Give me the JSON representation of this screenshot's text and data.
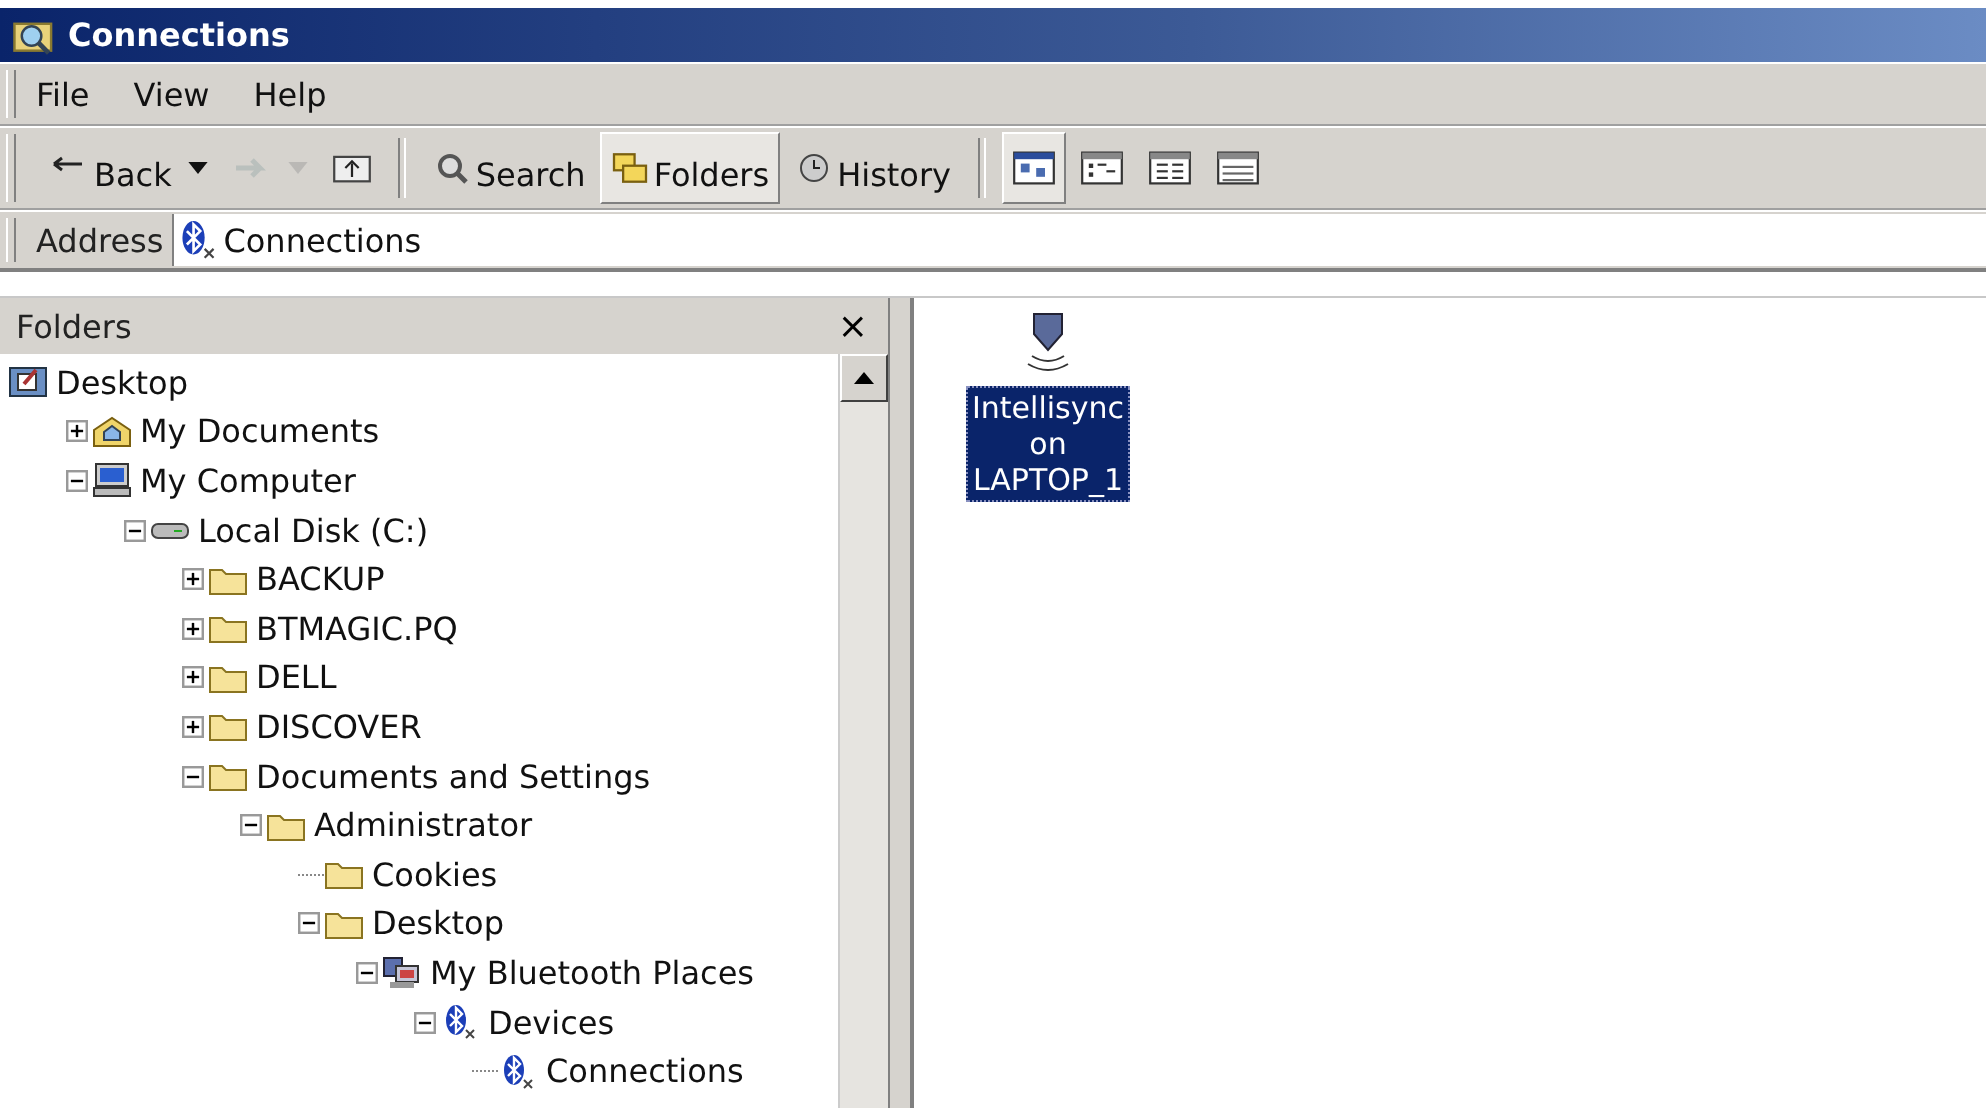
{
  "window": {
    "title": "Connections"
  },
  "menu": [
    "File",
    "View",
    "Help"
  ],
  "toolbar": [
    {
      "kind": "back",
      "label": "Back",
      "disabled": false,
      "selected": false
    },
    {
      "kind": "forward",
      "disabled": true,
      "selected": false
    },
    {
      "kind": "up",
      "disabled": false,
      "selected": false
    },
    {
      "kind": "separator"
    },
    {
      "kind": "search",
      "label": "Search",
      "disabled": false,
      "selected": false
    },
    {
      "kind": "folders",
      "label": "Folders",
      "disabled": false,
      "selected": true
    },
    {
      "kind": "history",
      "label": "History",
      "disabled": false,
      "selected": false
    },
    {
      "kind": "separator"
    },
    {
      "kind": "view-large",
      "disabled": false,
      "selected": true
    },
    {
      "kind": "view-small",
      "disabled": false,
      "selected": false
    },
    {
      "kind": "view-list",
      "disabled": false,
      "selected": false
    },
    {
      "kind": "view-details",
      "disabled": false,
      "selected": false
    }
  ],
  "address": {
    "label": "Address",
    "value": "Connections"
  },
  "folders_pane": {
    "title": "Folders",
    "close": "×"
  },
  "tree": [
    {
      "label": "Desktop",
      "kind": "desktop",
      "children": [
        {
          "label": "My Documents",
          "kind": "documents",
          "expanded": false
        },
        {
          "label": "My Computer",
          "kind": "computer",
          "expanded": true,
          "children": [
            {
              "label": "Local Disk (C:)",
              "kind": "disk",
              "expanded": true,
              "children": [
                {
                  "label": "BACKUP",
                  "kind": "folder",
                  "expanded": false
                },
                {
                  "label": "BTMAGIC.PQ",
                  "kind": "folder",
                  "expanded": false
                },
                {
                  "label": "DELL",
                  "kind": "folder",
                  "expanded": false
                },
                {
                  "label": "DISCOVER",
                  "kind": "folder",
                  "expanded": false
                },
                {
                  "label": "Documents and Settings",
                  "kind": "folder",
                  "expanded": true,
                  "children": [
                    {
                      "label": "Administrator",
                      "kind": "folder",
                      "expanded": true,
                      "children": [
                        {
                          "label": "Cookies",
                          "kind": "folder"
                        },
                        {
                          "label": "Desktop",
                          "kind": "folder",
                          "expanded": true,
                          "children": [
                            {
                              "label": "My Bluetooth Places",
                              "kind": "bt-places",
                              "expanded": true,
                              "children": [
                                {
                                  "label": "Devices",
                                  "kind": "bluetooth",
                                  "expanded": true,
                                  "children": [
                                    {
                                      "label": "Connections",
                                      "kind": "bluetooth"
                                    }
                                  ]
                                }
                              ]
                            }
                          ]
                        }
                      ]
                    }
                  ]
                }
              ]
            }
          ]
        }
      ]
    }
  ],
  "items": [
    {
      "label": "Intellisync on LAPTOP_1",
      "selected": true
    }
  ]
}
